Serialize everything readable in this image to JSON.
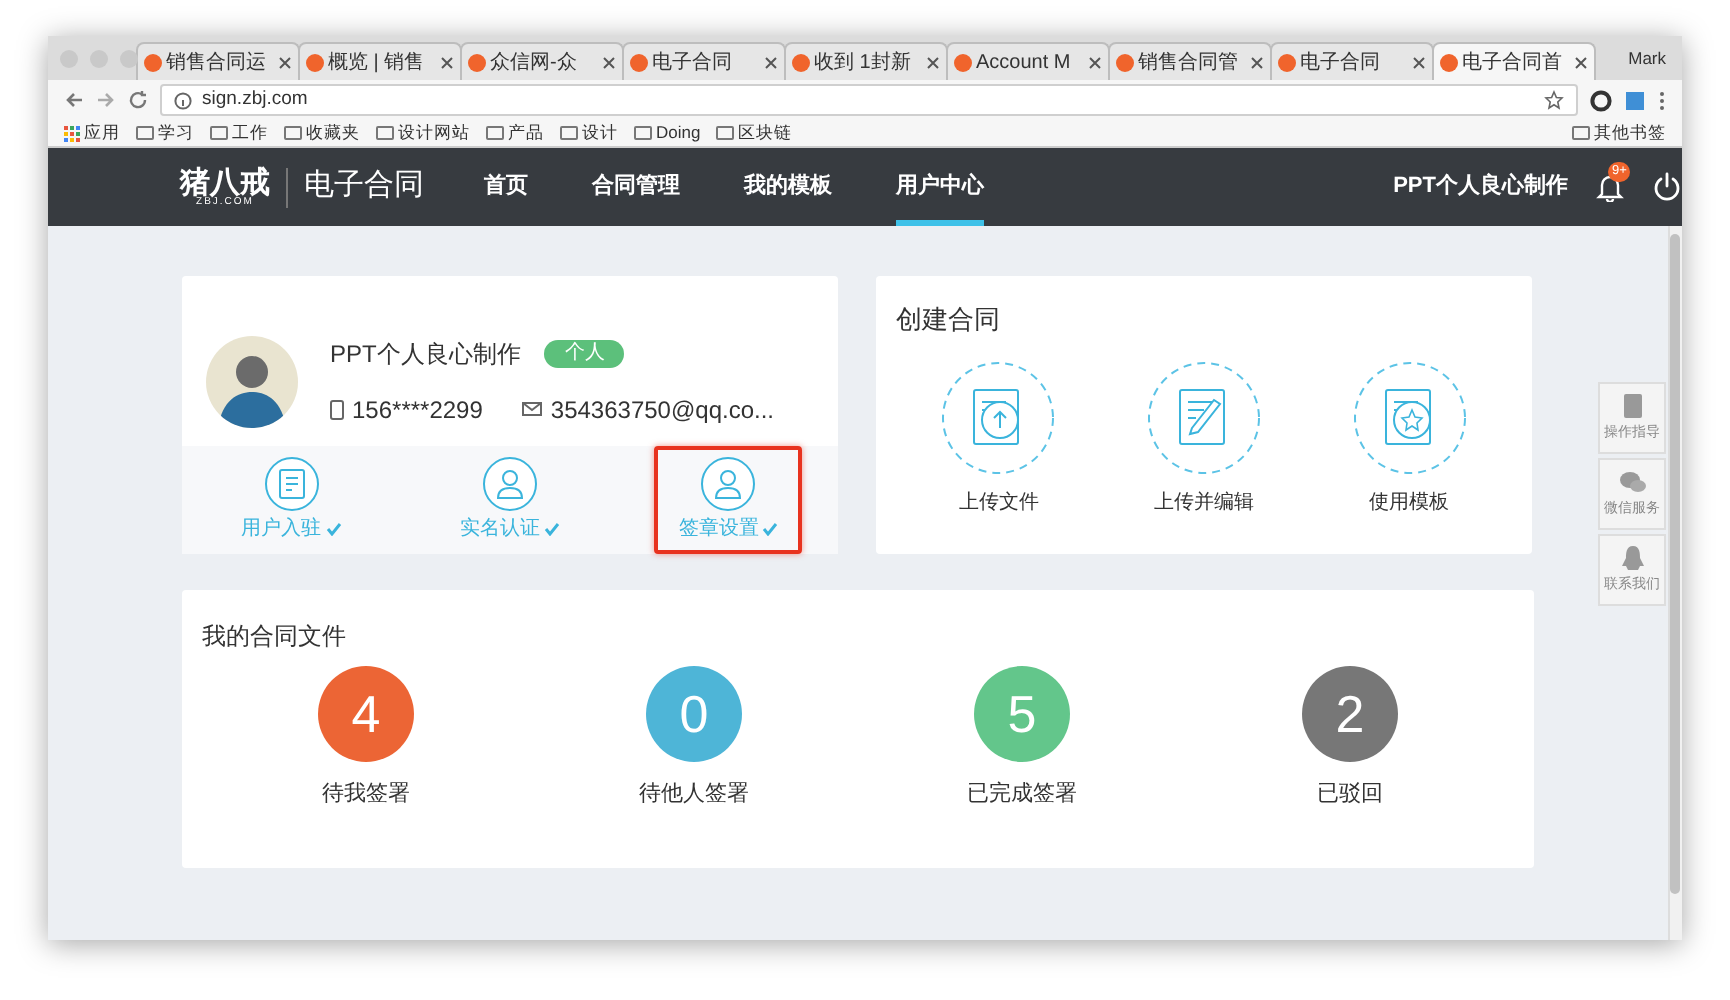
{
  "browser": {
    "tabs": [
      {
        "title": "销售合同运",
        "selected": false
      },
      {
        "title": "概览 | 销售",
        "selected": false
      },
      {
        "title": "众信网-众",
        "selected": false
      },
      {
        "title": "电子合同",
        "selected": false
      },
      {
        "title": "收到 1封新",
        "selected": false
      },
      {
        "title": "Account M",
        "selected": false
      },
      {
        "title": "销售合同管",
        "selected": false
      },
      {
        "title": "电子合同",
        "selected": false
      },
      {
        "title": "电子合同首",
        "selected": true
      }
    ],
    "profile": "Mark",
    "url": "sign.zbj.com",
    "bookmarks": [
      "应用",
      "学习",
      "工作",
      "收藏夹",
      "设计网站",
      "产品",
      "设计",
      "Doing",
      "区块链"
    ],
    "other_bookmarks": "其他书签"
  },
  "header": {
    "logo": "猪八戒",
    "logo_sub": "ZBJ.COM",
    "product": "电子合同",
    "nav": [
      {
        "label": "首页",
        "selected": false
      },
      {
        "label": "合同管理",
        "selected": false
      },
      {
        "label": "我的模板",
        "selected": false
      },
      {
        "label": "用户中心",
        "selected": true
      }
    ],
    "user": "PPT个人良心制作",
    "notification_badge": "9+"
  },
  "profile_card": {
    "name": "PPT个人良心制作",
    "tag": "个人",
    "phone": "156****2299",
    "email": "354363750@qq.co...",
    "actions": [
      {
        "label": "用户入驻",
        "kind": "register",
        "verified": true,
        "highlighted": false
      },
      {
        "label": "实名认证",
        "kind": "person",
        "verified": true,
        "highlighted": false
      },
      {
        "label": "签章设置",
        "kind": "seal",
        "verified": true,
        "highlighted": true
      }
    ]
  },
  "create_card": {
    "title": "创建合同",
    "items": [
      {
        "label": "上传文件",
        "kind": "upload"
      },
      {
        "label": "上传并编辑",
        "kind": "edit"
      },
      {
        "label": "使用模板",
        "kind": "template"
      }
    ]
  },
  "files_card": {
    "title": "我的合同文件",
    "stats": [
      {
        "count": "4",
        "label": "待我签署",
        "color": "#ec6535"
      },
      {
        "count": "0",
        "label": "待他人签署",
        "color": "#4eb5d7"
      },
      {
        "count": "5",
        "label": "已完成签署",
        "color": "#63c68b"
      },
      {
        "count": "2",
        "label": "已驳回",
        "color": "#777777"
      }
    ]
  },
  "side_tools": [
    {
      "label": "操作指导",
      "kind": "book"
    },
    {
      "label": "微信服务",
      "kind": "chat"
    },
    {
      "label": "联系我们",
      "kind": "qq"
    }
  ]
}
